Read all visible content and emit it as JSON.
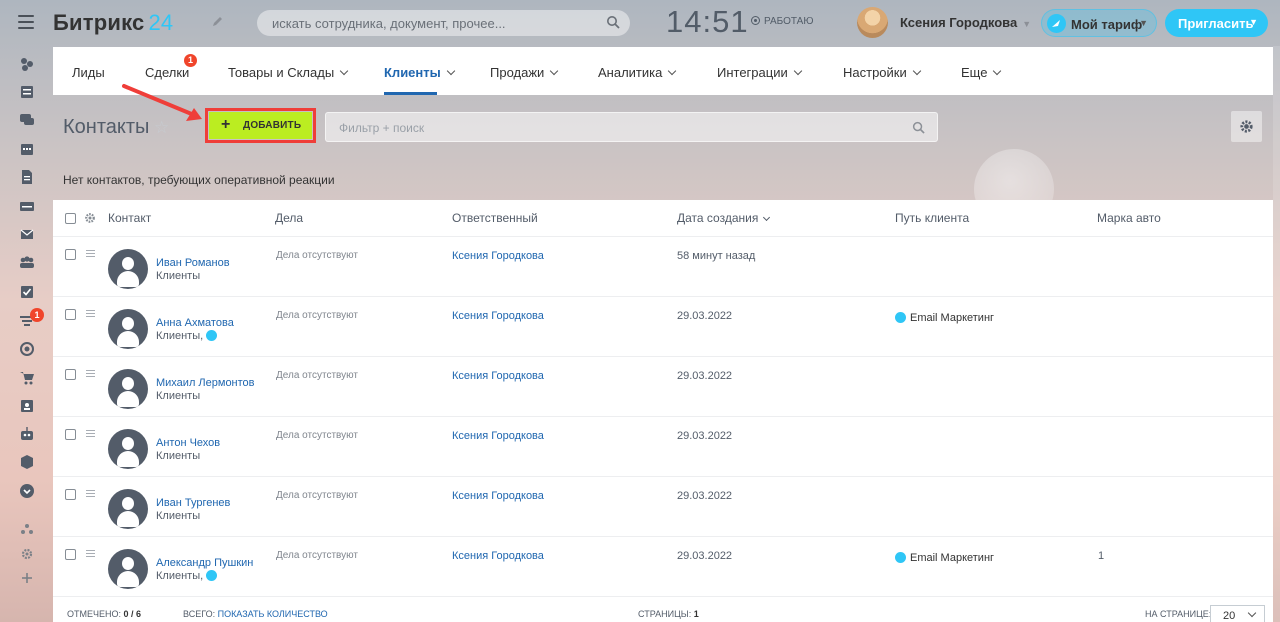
{
  "header": {
    "logo_main": "Битрикс",
    "logo_num": "24",
    "search_placeholder": "искать сотрудника, документ, прочее...",
    "clock": "14:51",
    "work_status": "РАБОТАЮ",
    "user_name": "Ксения Городкова",
    "tariff_label": "Мой тариф",
    "invite_label": "Пригласить"
  },
  "leftbar": {
    "icons": [
      "sliders-icon",
      "newspaper-icon",
      "chat-icon",
      "calendar-icon",
      "document-icon",
      "drive-icon",
      "mail-icon",
      "group-icon",
      "tasks-icon",
      "crm-funnel-icon",
      "target-icon",
      "cart-icon",
      "contact-card-icon",
      "robot-icon",
      "box-icon",
      "chevron-circle-icon",
      "structure-icon",
      "settings-icon",
      "add-icon"
    ],
    "crm_badge": "1"
  },
  "menu": {
    "items": [
      {
        "label": "Лиды",
        "chevron": false
      },
      {
        "label": "Сделки",
        "chevron": false,
        "badge": "1"
      },
      {
        "label": "Товары и Склады",
        "chevron": true
      },
      {
        "label": "Клиенты",
        "chevron": true,
        "active": true
      },
      {
        "label": "Продажи",
        "chevron": true
      },
      {
        "label": "Аналитика",
        "chevron": true
      },
      {
        "label": "Интеграции",
        "chevron": true
      },
      {
        "label": "Настройки",
        "chevron": true
      },
      {
        "label": "Еще",
        "chevron": true
      }
    ]
  },
  "toolbar": {
    "title": "Контакты",
    "add_label": "ДОБАВИТЬ",
    "filter_placeholder": "Фильтр + поиск"
  },
  "notice": "Нет контактов, требующих оперативной реакции",
  "grid": {
    "columns": [
      "Контакт",
      "Дела",
      "Ответственный",
      "Дата создания",
      "Путь клиента",
      "Марка авто"
    ],
    "rows": [
      {
        "name": "Иван Романов",
        "type": "Клиенты",
        "type_bubble": false,
        "deals": "Дела отсутствуют",
        "responsible": "Ксения Городкова",
        "date": "58 минут назад",
        "path": "",
        "car": ""
      },
      {
        "name": "Анна Ахматова",
        "type": "Клиенты,",
        "type_bubble": true,
        "deals": "Дела отсутствуют",
        "responsible": "Ксения Городкова",
        "date": "29.03.2022",
        "path": "Email Маркетинг",
        "car": ""
      },
      {
        "name": "Михаил Лермонтов",
        "type": "Клиенты",
        "type_bubble": false,
        "deals": "Дела отсутствуют",
        "responsible": "Ксения Городкова",
        "date": "29.03.2022",
        "path": "",
        "car": ""
      },
      {
        "name": "Антон Чехов",
        "type": "Клиенты",
        "type_bubble": false,
        "deals": "Дела отсутствуют",
        "responsible": "Ксения Городкова",
        "date": "29.03.2022",
        "path": "",
        "car": ""
      },
      {
        "name": "Иван Тургенев",
        "type": "Клиенты",
        "type_bubble": false,
        "deals": "Дела отсутствуют",
        "responsible": "Ксения Городкова",
        "date": "29.03.2022",
        "path": "",
        "car": ""
      },
      {
        "name": "Александр Пушкин",
        "type": "Клиенты,",
        "type_bubble": true,
        "deals": "Дела отсутствуют",
        "responsible": "Ксения Городкова",
        "date": "29.03.2022",
        "path": "Email Маркетинг",
        "car": "1"
      }
    ]
  },
  "footer": {
    "selected_label": "ОТМЕЧЕНО:",
    "selected_value": "0 / 6",
    "total_label": "ВСЕГО:",
    "total_link": "ПОКАЗАТЬ КОЛИЧЕСТВО",
    "pages_label": "СТРАНИЦЫ:",
    "pages_value": "1",
    "per_page_label": "НА СТРАНИЦЕ:",
    "per_page_value": "20"
  }
}
